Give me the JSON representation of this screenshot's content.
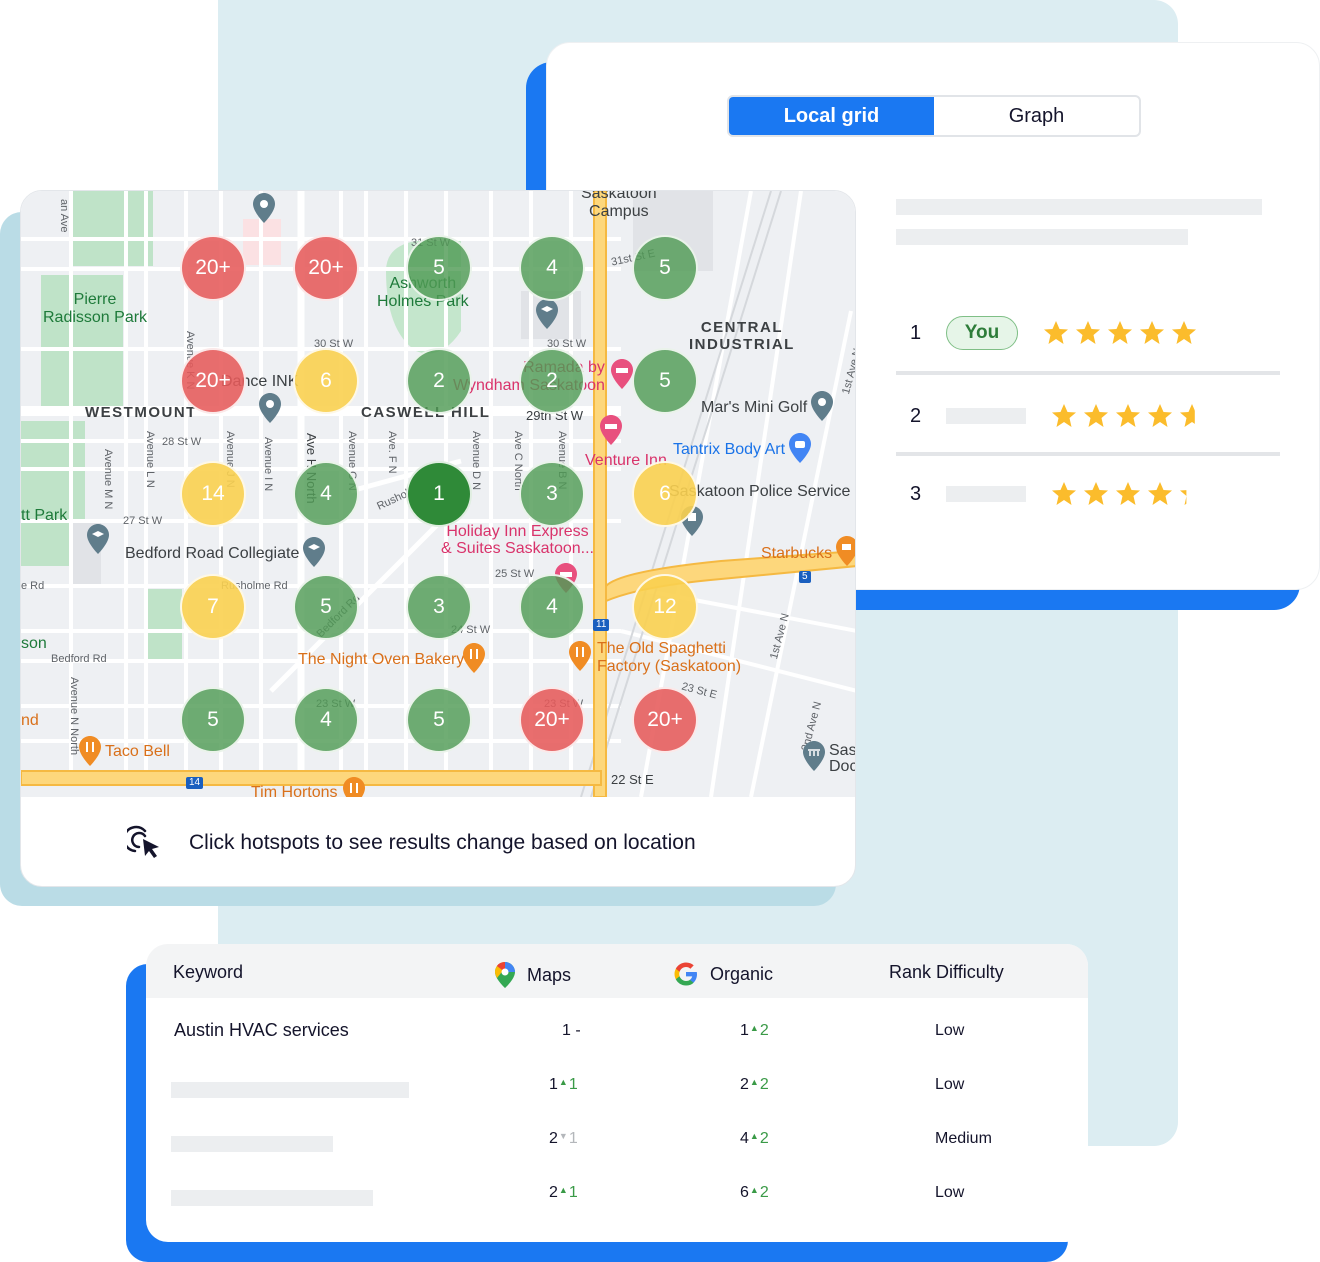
{
  "toggle": {
    "options": [
      "Local grid",
      "Graph"
    ],
    "active": "Local grid"
  },
  "ranking": {
    "rows": [
      {
        "rank": "1",
        "badge": "You",
        "rating": 5.0
      },
      {
        "rank": "2",
        "badge": null,
        "rating": 4.6
      },
      {
        "rank": "3",
        "badge": null,
        "rating": 4.3
      }
    ]
  },
  "map": {
    "hotspots": [
      {
        "row": 0,
        "col": 0,
        "value": "20+",
        "level": "red"
      },
      {
        "row": 0,
        "col": 1,
        "value": "20+",
        "level": "red"
      },
      {
        "row": 0,
        "col": 2,
        "value": "5",
        "level": "green"
      },
      {
        "row": 0,
        "col": 3,
        "value": "4",
        "level": "green"
      },
      {
        "row": 0,
        "col": 4,
        "value": "5",
        "level": "green"
      },
      {
        "row": 1,
        "col": 0,
        "value": "20+",
        "level": "red"
      },
      {
        "row": 1,
        "col": 1,
        "value": "6",
        "level": "yellow"
      },
      {
        "row": 1,
        "col": 2,
        "value": "2",
        "level": "green"
      },
      {
        "row": 1,
        "col": 3,
        "value": "2",
        "level": "green"
      },
      {
        "row": 1,
        "col": 4,
        "value": "5",
        "level": "green"
      },
      {
        "row": 2,
        "col": 0,
        "value": "14",
        "level": "yellow"
      },
      {
        "row": 2,
        "col": 1,
        "value": "4",
        "level": "green"
      },
      {
        "row": 2,
        "col": 2,
        "value": "1",
        "level": "dgreen"
      },
      {
        "row": 2,
        "col": 3,
        "value": "3",
        "level": "green"
      },
      {
        "row": 2,
        "col": 4,
        "value": "6",
        "level": "yellow"
      },
      {
        "row": 3,
        "col": 0,
        "value": "7",
        "level": "yellow"
      },
      {
        "row": 3,
        "col": 1,
        "value": "5",
        "level": "green"
      },
      {
        "row": 3,
        "col": 2,
        "value": "3",
        "level": "green"
      },
      {
        "row": 3,
        "col": 3,
        "value": "4",
        "level": "green"
      },
      {
        "row": 3,
        "col": 4,
        "value": "12",
        "level": "yellow"
      },
      {
        "row": 4,
        "col": 0,
        "value": "5",
        "level": "green"
      },
      {
        "row": 4,
        "col": 1,
        "value": "4",
        "level": "green"
      },
      {
        "row": 4,
        "col": 2,
        "value": "5",
        "level": "green"
      },
      {
        "row": 4,
        "col": 3,
        "value": "20+",
        "level": "red"
      },
      {
        "row": 4,
        "col": 4,
        "value": "20+",
        "level": "red"
      }
    ],
    "labels": {
      "pierre_radisson": "Pierre\nRadisson Park",
      "ashworth": "Ashworth\nHolmes Park",
      "campus": "Saskatoon\nCampus",
      "central_industrial": "CENTRAL\nINDUSTRIAL",
      "westmount": "WESTMOUNT",
      "caswell": "CASWELL HILL",
      "dance": "Dance INK",
      "ramada": "Ramada by\nWyndham Saskatoon",
      "mars": "Mar's Mini Golf",
      "tantrix": "Tantrix Body Art",
      "venture": "Venture Inn",
      "police": "Saskatoon Police Service",
      "holiday": "Holiday Inn Express\n& Suites Saskatoon...",
      "starbucks": "Starbucks",
      "bedford_collegiate": "Bedford Road Collegiate",
      "night_oven": "The Night Oven Bakery",
      "spaghetti": "The Old Spaghetti\nFactory (Saskatoon)",
      "taco": "Taco Bell",
      "tim": "Tim Hortons",
      "sask_doc": "Sas\nDoc",
      "tt_park": "tt Park",
      "son": "son",
      "nd": "nd",
      "s31w": "31 St W",
      "s31e": "31st St E",
      "s30w_a": "30 St W",
      "s30w_b": "30 St W",
      "s29w": "29th St W",
      "s28w": "28 St W",
      "s27w": "27 St W",
      "s25w": "25 St W",
      "s24w": "24 St W",
      "s23w_a": "23 St W",
      "s23w_b": "23 St W",
      "s23e": "23 St E",
      "s22e": "22 St E",
      "rusholme": "Rusholme Rd",
      "rusholme_p": "Rusholme Pl",
      "bedford_rd": "Bedford Rd",
      "bedford_rd2": "Bedford Rd",
      "e_rd": "e Rd",
      "ave_1n": "1st Ave N",
      "ave_1n_b": "1st Ave N",
      "ave_2n": "2nd Ave N",
      "ave_mn": "Avenue M N",
      "ave_ln": "Avenue L N",
      "ave_jn": "Avenue J N",
      "ave_in": "Avenue I N",
      "ave_hn": "Ave H North",
      "ave_gn": "Avenue G N",
      "ave_fn": "Ave. F N",
      "ave_dn": "Avenue D N",
      "ave_cn": "Ave C North",
      "ave_bn": "Avenue B N",
      "ave_kn": "Avenue K N",
      "ave_nn": "Avenue N North",
      "an_ave": "an Ave",
      "hwy11": "11",
      "hwy5": "5",
      "hwy14": "14"
    }
  },
  "map_footer": {
    "hint": "Click hotspots to see results change based on location"
  },
  "table": {
    "headers": {
      "keyword": "Keyword",
      "maps": "Maps",
      "organic": "Organic",
      "difficulty": "Rank Difficulty"
    },
    "rows": [
      {
        "keyword": "Austin HVAC services",
        "maps_rank": "1",
        "maps_delta": "-",
        "maps_dir": "flat",
        "organic_rank": "1",
        "organic_delta": "2",
        "organic_dir": "up",
        "difficulty": "Low"
      },
      {
        "keyword": null,
        "maps_rank": "1",
        "maps_delta": "1",
        "maps_dir": "up",
        "organic_rank": "2",
        "organic_delta": "2",
        "organic_dir": "up",
        "difficulty": "Low"
      },
      {
        "keyword": null,
        "maps_rank": "2",
        "maps_delta": "1",
        "maps_dir": "down",
        "organic_rank": "4",
        "organic_delta": "2",
        "organic_dir": "up",
        "difficulty": "Medium"
      },
      {
        "keyword": null,
        "maps_rank": "2",
        "maps_delta": "1",
        "maps_dir": "up",
        "organic_rank": "6",
        "organic_delta": "2",
        "organic_dir": "up",
        "difficulty": "Low"
      }
    ]
  },
  "colors": {
    "accent_blue": "#1a78f2",
    "hotspot_red": "#e65a5a",
    "hotspot_yellow": "#fad050",
    "hotspot_green": "#509b55",
    "hotspot_dark_green": "#2f8a38",
    "star": "#fbbc2c",
    "delta_up": "#3a9a47"
  }
}
